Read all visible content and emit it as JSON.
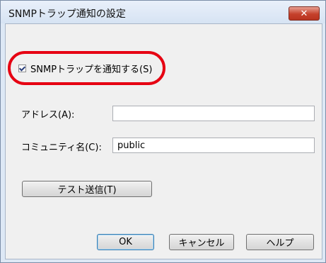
{
  "window": {
    "title": "SNMPトラップ通知の設定",
    "close_icon": "close-icon"
  },
  "notify_checkbox": {
    "label": "SNMPトラップを通知する(S)",
    "checked": true,
    "highlight_color": "#e60012"
  },
  "address": {
    "label": "アドレス(A):",
    "value": ""
  },
  "community": {
    "label": "コミュニティ名(C):",
    "value": "public"
  },
  "buttons": {
    "test": "テスト送信(T)",
    "ok": "OK",
    "cancel": "キャンセル",
    "help": "ヘルプ"
  }
}
